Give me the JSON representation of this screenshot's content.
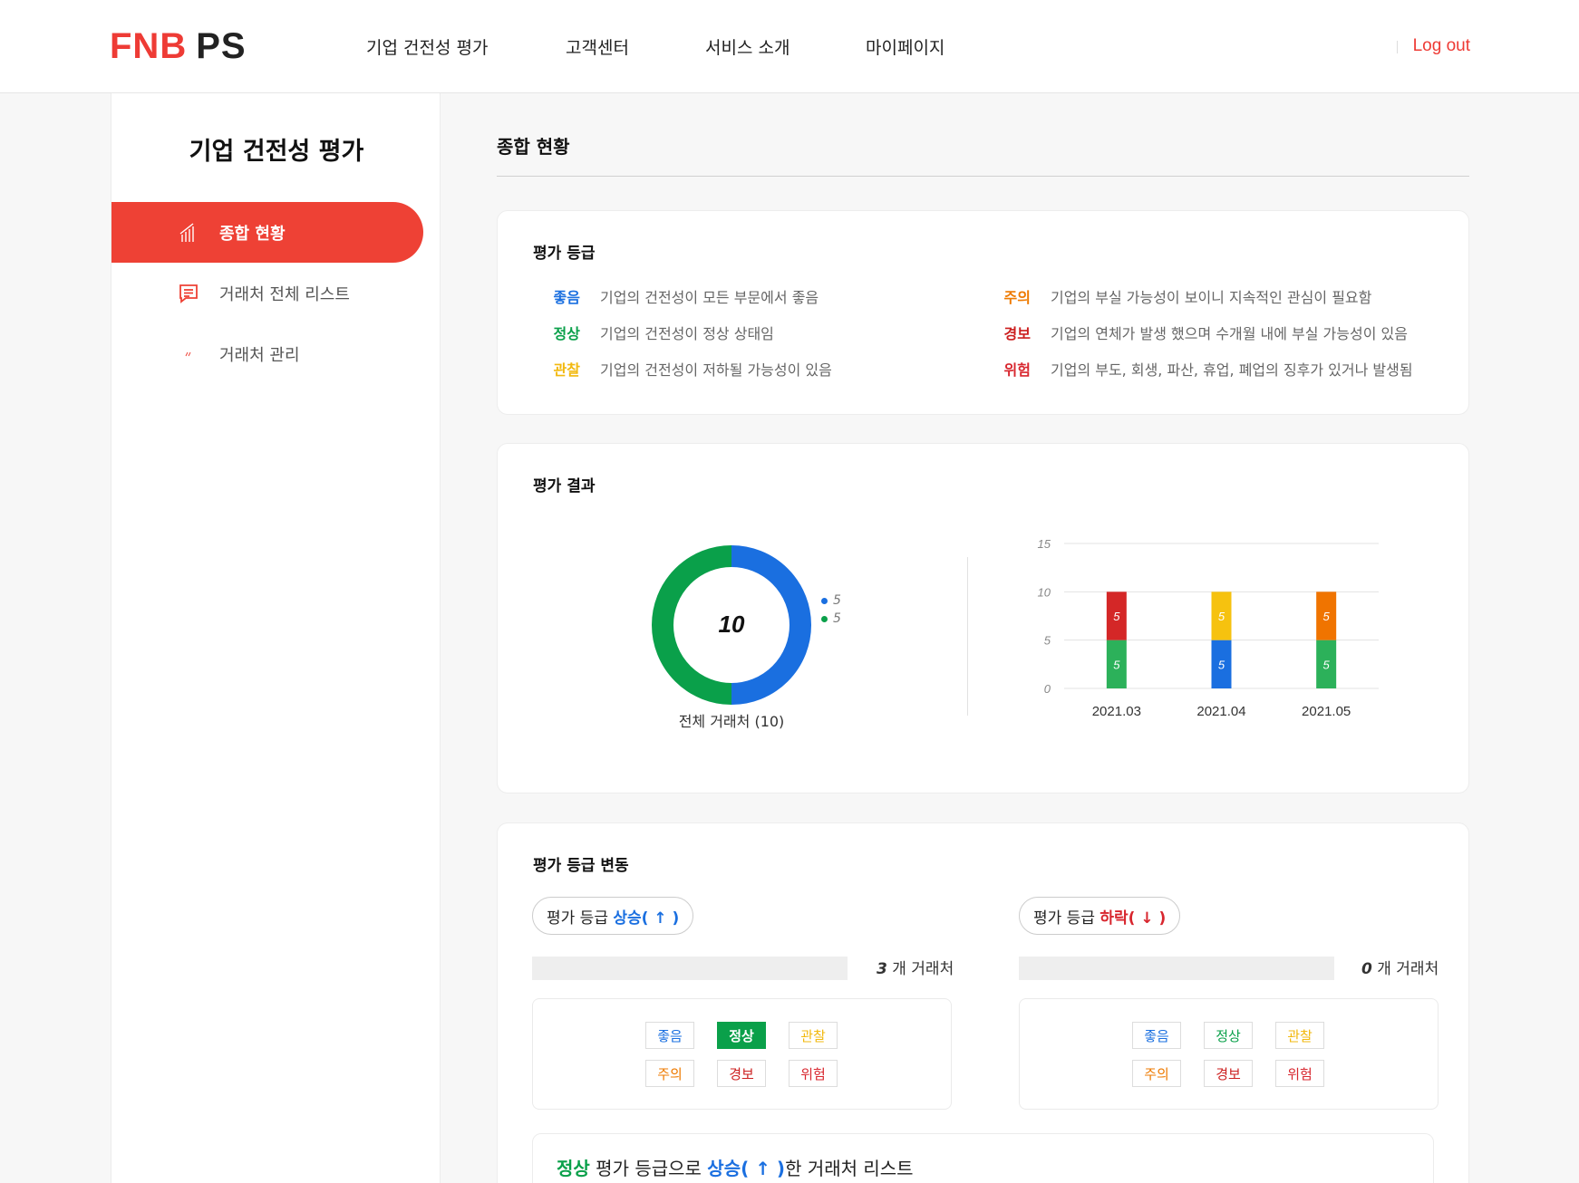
{
  "header": {
    "logo_left": "FNB",
    "logo_right": "PS",
    "nav": [
      "기업 건전성 평가",
      "고객센터",
      "서비스 소개",
      "마이페이지"
    ],
    "logout": "Log out"
  },
  "sidebar": {
    "title": "기업 건전성 평가",
    "items": [
      {
        "label": "종합 현황",
        "icon": "bar-chart-icon",
        "active": true
      },
      {
        "label": "거래처 전체 리스트",
        "icon": "list-icon",
        "active": false
      },
      {
        "label": "거래처 관리",
        "icon": "manage-icon",
        "active": false
      }
    ]
  },
  "main": {
    "title": "종합 현황",
    "grades": {
      "title": "평가 등급",
      "items": [
        {
          "grade": "좋음",
          "desc": "기업의 건전성이 모든 부문에서 좋음",
          "color": "#1a6fe0"
        },
        {
          "grade": "정상",
          "desc": "기업의 건전성이 정상 상태임",
          "color": "#0aa04a"
        },
        {
          "grade": "관찰",
          "desc": "기업의 건전성이 저하될 가능성이 있음",
          "color": "#f2b90f"
        },
        {
          "grade": "주의",
          "desc": "기업의 부실 가능성이 보이니 지속적인 관심이 필요함",
          "color": "#ee7a00"
        },
        {
          "grade": "경보",
          "desc": "기업의 연체가 발생 했으며 수개월 내에 부실 가능성이 있음",
          "color": "#cc1f1f"
        },
        {
          "grade": "위험",
          "desc": "기업의 부도, 회생, 파산, 휴업, 폐업의 징후가 있거나 발생됨",
          "color": "#d8262e"
        }
      ]
    },
    "result": {
      "title": "평가 결과",
      "donut_center": "10",
      "donut_label": "전체 거래처 (10)",
      "legend": [
        "5",
        "5"
      ]
    },
    "change": {
      "title": "평가 등급 변동",
      "up": {
        "prefix": "평가 등급 ",
        "word": "상승( ↑ )",
        "count": "3",
        "count_suffix": "개 거래처"
      },
      "down": {
        "prefix": "평가 등급 ",
        "word": "하락( ↓ )",
        "count": "0",
        "count_suffix": "개 거래처"
      },
      "tags": [
        "좋음",
        "정상",
        "관찰",
        "주의",
        "경보",
        "위험"
      ],
      "list_title_grade": "정상",
      "list_title_mid": " 평가 등급으로 ",
      "list_title_word": "상승( ↑ )",
      "list_title_tail": "한 거래처 리스트"
    }
  },
  "chart_data": [
    {
      "type": "pie",
      "categories": [
        "좋음",
        "정상"
      ],
      "values": [
        5,
        5
      ],
      "colors": [
        "#1a6fe0",
        "#0aa04a"
      ]
    },
    {
      "type": "bar",
      "categories": [
        "2021.03",
        "2021.04",
        "2021.05"
      ],
      "ylim": [
        0,
        15
      ],
      "yticks": [
        0,
        5,
        10,
        15
      ],
      "stacked": true,
      "series": [
        {
          "values": [
            5,
            5,
            5
          ],
          "colors": [
            "#2cb15a",
            "#1a6fe0",
            "#2cb15a"
          ]
        },
        {
          "values": [
            5,
            5,
            5
          ],
          "colors": [
            "#d42727",
            "#f6c20f",
            "#f07400"
          ]
        }
      ],
      "grid": true
    }
  ]
}
